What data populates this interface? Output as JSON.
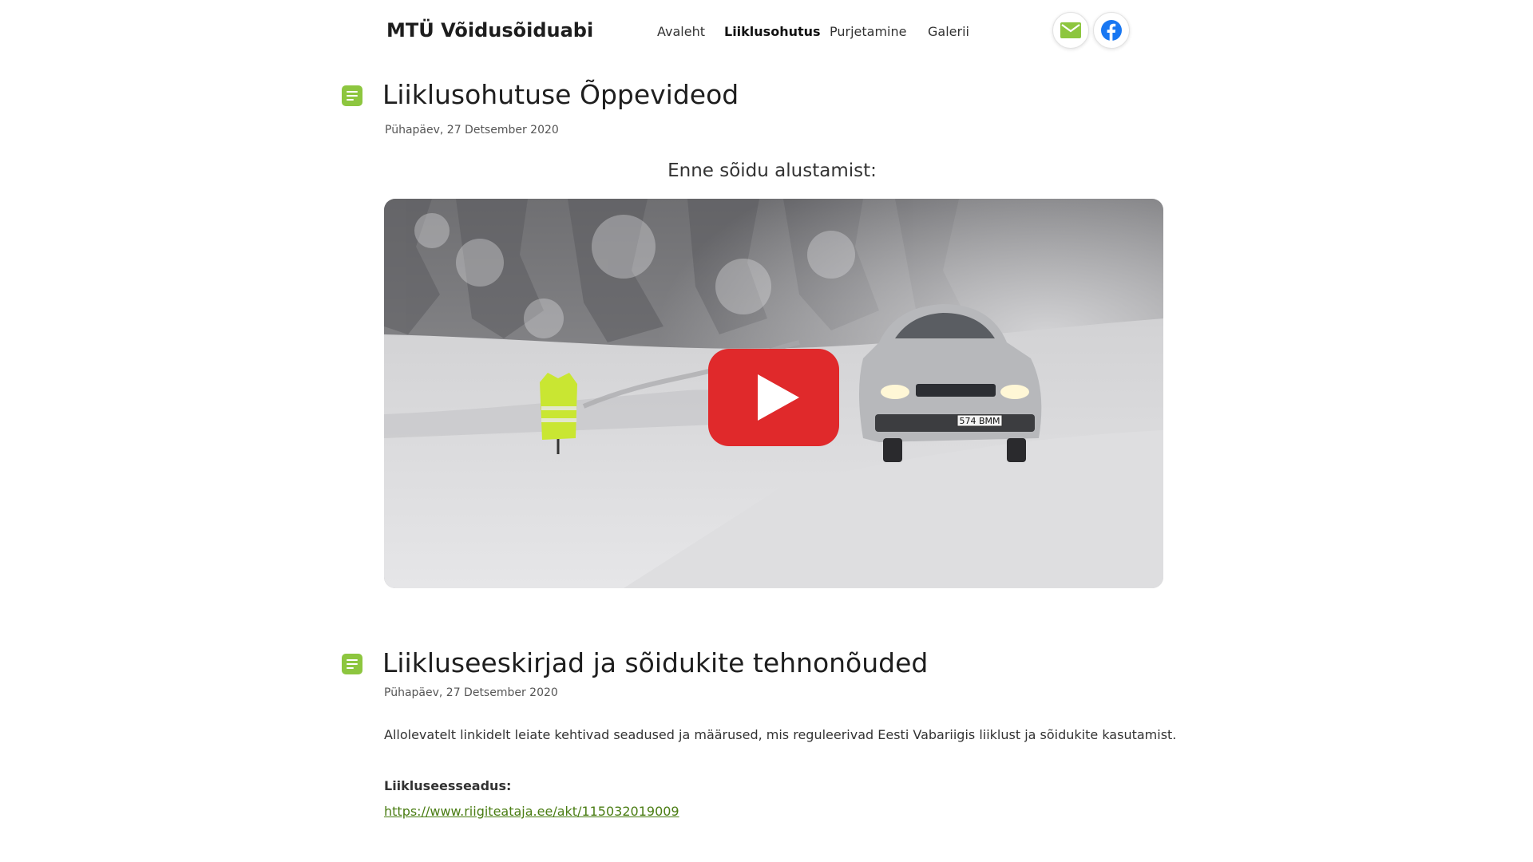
{
  "header": {
    "site_title": "MTÜ Võidusõiduabi",
    "nav": [
      "Avaleht",
      "Liiklusohutus",
      "Purjetamine",
      "Galerii"
    ],
    "active_nav": "Liiklusohutus",
    "social": [
      {
        "icon": "mail-icon",
        "color": "#8dc63f"
      },
      {
        "icon": "facebook-icon",
        "color": "#1877f2"
      }
    ]
  },
  "posts": [
    {
      "title": "Liiklusohutuse Õppevideod",
      "date": "Pühapäev, 27 Detsember 2020",
      "subheading": "Enne sõidu alustamist:",
      "video": {
        "plate_text": "574 BMM",
        "play_button_color": "#e0292b"
      }
    },
    {
      "title": "Liikluseeskirjad ja sõidukite tehnonõuded",
      "date": "Pühapäev, 27 Detsember 2020",
      "intro": "Allolevatelt linkidelt leiate kehtivad seadused ja määrused, mis reguleerivad Eesti Vabariigis liiklust ja sõidukite kasutamist.",
      "section_label": "Liikluseesseadus:",
      "link_text": "https://www.riigiteataja.ee/akt/115032019009"
    }
  ],
  "colors": {
    "accent": "#8dc63f",
    "link": "#4a7d13"
  }
}
